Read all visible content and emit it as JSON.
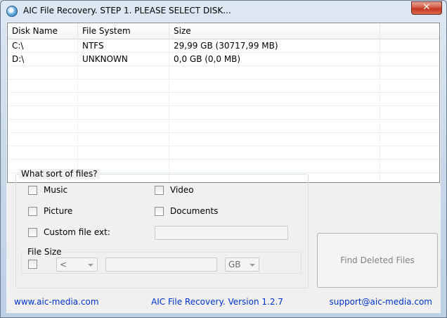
{
  "window": {
    "title": "AIC File Recovery. STEP 1. PLEASE SELECT DISK...",
    "close_glyph": "✕"
  },
  "disk_list": {
    "columns": [
      "Disk Name",
      "File System",
      "Size"
    ],
    "rows": [
      [
        "C:\\",
        "NTFS",
        "29,99 GB (30717,99 MB)"
      ],
      [
        "D:\\",
        "UNKNOWN",
        "0,0 GB (0,0 MB)"
      ]
    ]
  },
  "file_types": {
    "legend": "What sort of files?",
    "music": "Music",
    "video": "Video",
    "picture": "Picture",
    "documents": "Documents",
    "custom": "Custom file ext:",
    "custom_value": ""
  },
  "file_size": {
    "legend": "File Size",
    "operator": "<",
    "value": "",
    "unit": "GB"
  },
  "find_button": "Find Deleted Files",
  "footer": {
    "website": "www.aic-media.com",
    "version": "AIC File Recovery. Version 1.2.7",
    "email": "support@aic-media.com"
  },
  "colors": {
    "link": "#0033cc",
    "disabled_text": "#838383"
  }
}
